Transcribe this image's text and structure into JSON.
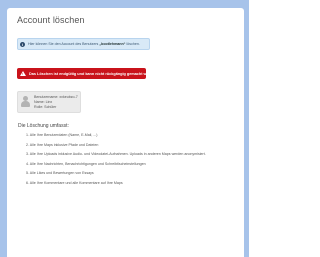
{
  "page": {
    "title": "Account löschen"
  },
  "info_box": {
    "icon": "info-icon",
    "text_prefix": "Hier können Sie den Account des Benutzers ",
    "username": "„bootlehmann“",
    "text_suffix": " löschen."
  },
  "warning_box": {
    "icon": "warning-icon",
    "text": "Das Löschen ist endgültig und kann nicht rückgängig gemacht werden!"
  },
  "user_card": {
    "icon": "user-avatar-icon",
    "username_line": "Benutzername: xxkeubzo-7",
    "name_line": "Name: Linx",
    "role_line": "Rolle: Schüler"
  },
  "deletion": {
    "heading": "Die Löschung umfasst:",
    "items": [
      "1. Alle Ihre Benutzerdaten (Name, E-Mail, ...)",
      "2. Alle Ihre Maps inklusive Pfade und Dateien",
      "3. Alle Ihre Uploads inklusive Audio- und Videodatei-Aufnahmen. Uploads in anderen Maps werden anonymisiert.",
      "4. Alle Ihre Nachrichten, Benachrichtigungen und Schreibtischeinstellungen",
      "5. Alle Likes und Bewertungen von Essays",
      "6. Alle Ihre Kommentare und alle Kommentare auf Ihre Maps"
    ]
  },
  "colors": {
    "frame": "#a7c3ea",
    "info_bg": "#d8e9f7",
    "warning_bg": "#c9131b",
    "card_bg": "#ebebeb"
  }
}
